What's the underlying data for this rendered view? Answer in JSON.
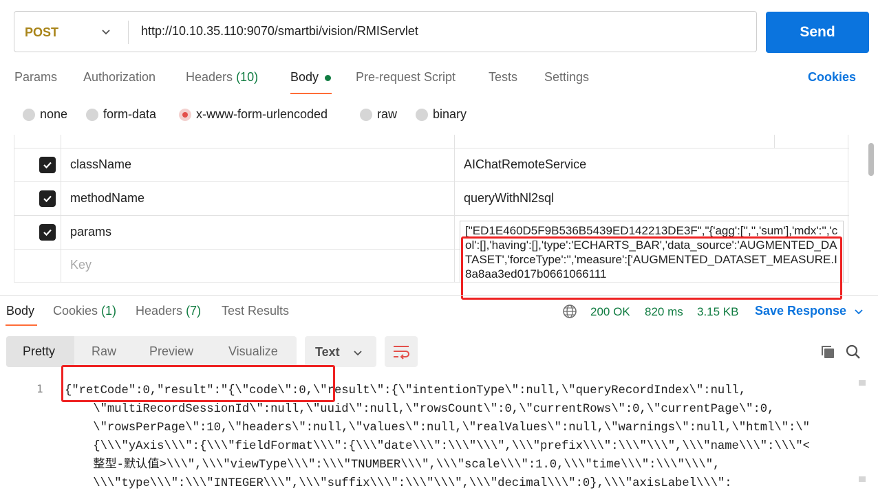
{
  "request": {
    "method": "POST",
    "url": "http://10.10.35.110:9070/smartbi/vision/RMIServlet",
    "send_label": "Send"
  },
  "request_tabs": {
    "params": "Params",
    "authorization": "Authorization",
    "headers": "Headers",
    "headers_count": "(10)",
    "body": "Body",
    "prerequest": "Pre-request Script",
    "tests": "Tests",
    "settings": "Settings",
    "cookies": "Cookies"
  },
  "body_types": {
    "none": "none",
    "form_data": "form-data",
    "urlencoded": "x-www-form-urlencoded",
    "raw": "raw",
    "binary": "binary",
    "selected": "x-www-form-urlencoded"
  },
  "params_table": {
    "rows": [
      {
        "key": "className",
        "value": "AIChatRemoteService",
        "checked": true
      },
      {
        "key": "methodName",
        "value": "queryWithNl2sql",
        "checked": true
      },
      {
        "key": "params",
        "value": "[\"ED1E460D5F9B536B5439ED142213DE3F\",\"{'agg':['','','sum'],'mdx':'','col':[],'having':[],'type':'ECHARTS_BAR','data_source':'AUGMENTED_DATASET','forceType':'','measure':['AUGMENTED_DATASET_MEASURE.I8a8aa3ed017b0661066111",
        "checked": true
      }
    ],
    "key_placeholder": "Key"
  },
  "response": {
    "tabs": {
      "body": "Body",
      "cookies": "Cookies",
      "cookies_count": "(1)",
      "headers": "Headers",
      "headers_count": "(7)",
      "test_results": "Test Results"
    },
    "status": "200 OK",
    "time": "820 ms",
    "size": "3.15 KB",
    "save_label": "Save Response",
    "views": {
      "pretty": "Pretty",
      "raw": "Raw",
      "preview": "Preview",
      "visualize": "Visualize"
    },
    "format": "Text",
    "line_number": "1",
    "code_lines": [
      "{\"retCode\":0,\"result\":\"{\\\"code\\\":0,\\\"result\\\":{\\\"intentionType\\\":null,\\\"queryRecordIndex\\\":null,",
      "    \\\"multiRecordSessionId\\\":null,\\\"uuid\\\":null,\\\"rowsCount\\\":0,\\\"currentRows\\\":0,\\\"currentPage\\\":0,",
      "    \\\"rowsPerPage\\\":10,\\\"headers\\\":null,\\\"values\\\":null,\\\"realValues\\\":null,\\\"warnings\\\":null,\\\"html\\\":\\\"",
      "    {\\\\\\\"yAxis\\\\\\\":{\\\\\\\"fieldFormat\\\\\\\":{\\\\\\\"date\\\\\\\":\\\\\\\"\\\\\\\",\\\\\\\"prefix\\\\\\\":\\\\\\\"\\\\\\\",\\\\\\\"name\\\\\\\":\\\\\\\"<",
      "    整型-默认值>\\\\\\\",\\\\\\\"viewType\\\\\\\":\\\\\\\"TNUMBER\\\\\\\",\\\\\\\"scale\\\\\\\":1.0,\\\\\\\"time\\\\\\\":\\\\\\\"\\\\\\\",",
      "    \\\\\\\"type\\\\\\\":\\\\\\\"INTEGER\\\\\\\",\\\\\\\"suffix\\\\\\\":\\\\\\\"\\\\\\\",\\\\\\\"decimal\\\\\\\":0},\\\\\\\"axisLabel\\\\\\\":"
    ]
  },
  "colors": {
    "accent": "#0b74de",
    "method": "#a9851a",
    "success": "#107c41",
    "tab_underline": "#ff6c37",
    "highlight_box": "#ee2222"
  },
  "icons": [
    "chevron-down-icon",
    "globe-icon",
    "wrap-lines-icon",
    "copy-icon",
    "search-icon",
    "checkbox-checked-icon"
  ]
}
